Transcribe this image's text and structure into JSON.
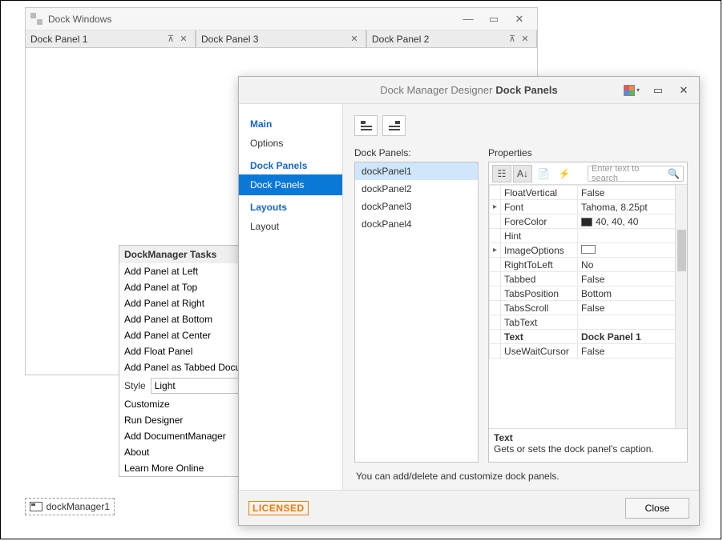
{
  "win": {
    "title": "Dock Windows",
    "panels": [
      "Dock Panel 1",
      "Dock Panel 3",
      "Dock Panel 2"
    ]
  },
  "tasks": {
    "header": "DockManager Tasks",
    "items": [
      "Add Panel at Left",
      "Add Panel at Top",
      "Add Panel at Right",
      "Add Panel at Bottom",
      "Add Panel at Center",
      "Add Float Panel",
      "Add Panel as Tabbed Docu"
    ],
    "style_label": "Style",
    "style_value": "Light",
    "items2": [
      "Customize",
      "Run Designer",
      "Add DocumentManager",
      "About",
      "Learn More Online"
    ]
  },
  "tray": {
    "name": "dockManager1"
  },
  "dlg": {
    "title_prefix": "Dock Manager Designer",
    "title_main": "Dock Panels",
    "side": {
      "cat1": "Main",
      "options": "Options",
      "cat2": "Dock Panels",
      "dockpanels": "Dock Panels",
      "cat3": "Layouts",
      "layout": "Layout"
    },
    "list_label": "Dock Panels:",
    "list": [
      "dockPanel1",
      "dockPanel2",
      "dockPanel3",
      "dockPanel4"
    ],
    "props_label": "Properties",
    "search_placeholder": "Enter text to search",
    "props": [
      {
        "k": "FloatVertical",
        "v": "False"
      },
      {
        "k": "Font",
        "v": "Tahoma, 8.25pt"
      },
      {
        "k": "ForeColor",
        "v": "40, 40, 40"
      },
      {
        "k": "Hint",
        "v": ""
      },
      {
        "k": "ImageOptions",
        "v": ""
      },
      {
        "k": "RightToLeft",
        "v": "No"
      },
      {
        "k": "Tabbed",
        "v": "False"
      },
      {
        "k": "TabsPosition",
        "v": "Bottom"
      },
      {
        "k": "TabsScroll",
        "v": "False"
      },
      {
        "k": "TabText",
        "v": ""
      },
      {
        "k": "Text",
        "v": "Dock Panel 1"
      },
      {
        "k": "UseWaitCursor",
        "v": "False"
      }
    ],
    "desc": {
      "name": "Text",
      "text": "Gets or sets the dock panel's caption."
    },
    "hint": "You can add/delete and customize dock panels.",
    "licensed": "LICENSED",
    "close": "Close"
  }
}
